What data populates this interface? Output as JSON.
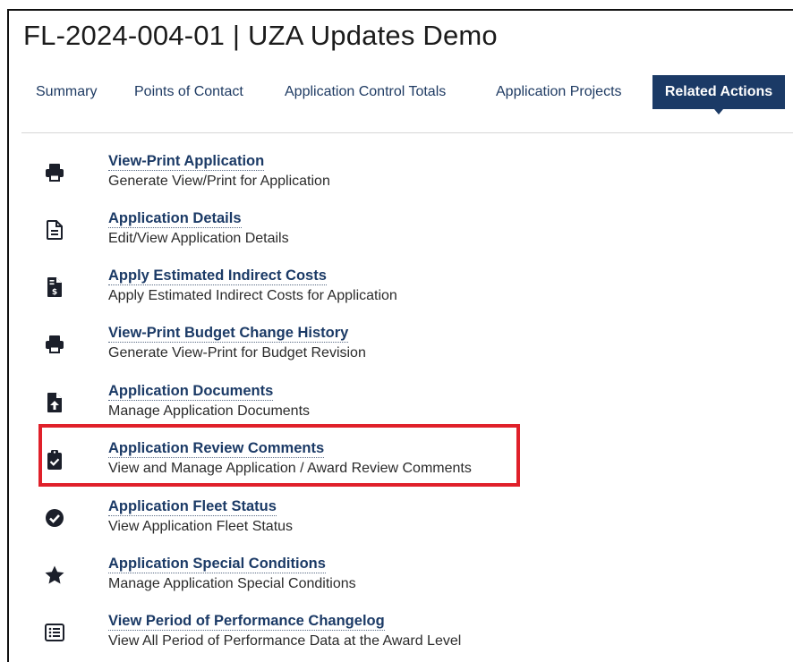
{
  "page": {
    "title": "FL-2024-004-01 | UZA Updates Demo"
  },
  "tabs": [
    {
      "label": "Summary",
      "active": false
    },
    {
      "label": "Points of Contact",
      "active": false
    },
    {
      "label": "Application Control Totals",
      "active": false
    },
    {
      "label": "Application Projects",
      "active": false
    },
    {
      "label": "Related Actions",
      "active": true
    }
  ],
  "actions": [
    {
      "icon": "printer-icon",
      "title": "View-Print Application",
      "description": "Generate View/Print for Application"
    },
    {
      "icon": "document-icon",
      "title": "Application Details",
      "description": "Edit/View Application Details"
    },
    {
      "icon": "invoice-dollar-icon",
      "title": "Apply Estimated Indirect Costs",
      "description": "Apply Estimated Indirect Costs for Application"
    },
    {
      "icon": "printer-icon",
      "title": "View-Print Budget Change History",
      "description": "Generate View-Print for Budget Revision"
    },
    {
      "icon": "file-upload-icon",
      "title": "Application Documents",
      "description": "Manage Application Documents"
    },
    {
      "icon": "clipboard-check-icon",
      "title": "Application Review Comments",
      "description": "View and Manage Application / Award Review Comments",
      "highlighted": true
    },
    {
      "icon": "check-circle-icon",
      "title": "Application Fleet Status",
      "description": "View Application Fleet Status"
    },
    {
      "icon": "star-icon",
      "title": "Application Special Conditions",
      "description": "Manage Application Special Conditions"
    },
    {
      "icon": "list-alt-icon",
      "title": "View Period of Performance Changelog",
      "description": "View All Period of Performance Data at the Award Level"
    }
  ],
  "colors": {
    "accent": "#1b3a66",
    "highlight": "#e0202a",
    "icon": "#1b1f2a"
  }
}
